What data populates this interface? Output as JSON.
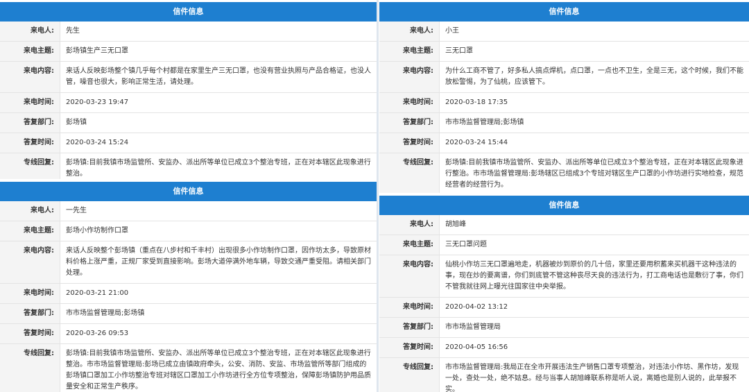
{
  "cards": [
    {
      "header": "信件信息",
      "rows": [
        {
          "label": "来电人:",
          "value": "先生"
        },
        {
          "label": "来电主题:",
          "value": "彭场镇生产三无口罩"
        },
        {
          "label": "来电内容:",
          "value": "来话人反映彭场整个镇几乎每个村都是在家里生产三无口罩，也没有营业执照与产品合格证，也没人管，噪音也很大，影响正常生活，请处理。"
        },
        {
          "label": "来电时间:",
          "value": "2020-03-23 19:47"
        },
        {
          "label": "答复部门:",
          "value": "彭场镇"
        },
        {
          "label": "答复时间:",
          "value": "2020-03-24 15:24"
        },
        {
          "label": "专线回复:",
          "value": "彭场镇:目前我镇市场监管所、安监办、派出所等单位已成立3个整治专班，正在对本辖区此现象进行整治。"
        }
      ]
    },
    {
      "header": "信件信息",
      "rows": [
        {
          "label": "来电人:",
          "value": "一先生"
        },
        {
          "label": "来电主题:",
          "value": "彭场小作坊制作口罩"
        },
        {
          "label": "来电内容:",
          "value": "来话人反映整个彭场镇（重点在八步村和千丰村）出现很多小作坊制作口罩，因作坊太多，导致原材料价格上涨严重，正规厂家受到直接影响。彭场大道停满外地车辆，导致交通严重受阻。请相关部门处理。"
        },
        {
          "label": "来电时间:",
          "value": "2020-03-21 21:00"
        },
        {
          "label": "答复部门:",
          "value": "市市场监督管理局;彭场镇"
        },
        {
          "label": "答复时间:",
          "value": "2020-03-26 09:53"
        },
        {
          "label": "专线回复:",
          "value": "彭场镇:目前我镇市场监管所、安监办、派出所等单位已成立3个整治专班，正在对本辖区此现象进行整治。市市场监督管理局:彭场已成立由镇政府牵头，公安、消防、安监、市场监管所等部门组成的彭场镇口罩加工小作坊整治专班对辖区口罩加工小作坊进行全方位专项整治，保障彭场镇防护用品质量安全和正常生产秩序。"
        }
      ]
    },
    {
      "header": "信件信息",
      "rows": [
        {
          "label": "来电人:",
          "value": "小王"
        },
        {
          "label": "来电主题:",
          "value": "三无口罩"
        },
        {
          "label": "来电内容:",
          "value": "为什么工商不管了，好多私人搞点焊机，点口罩，一点也不卫生，全是三无，这个时候，我们不能放松警惕，为了仙桃，应该管下。"
        },
        {
          "label": "来电时间:",
          "value": "2020-03-18 17:35"
        },
        {
          "label": "答复部门:",
          "value": "市市场监督管理局;彭场镇"
        },
        {
          "label": "答复时间:",
          "value": "2020-03-24 15:44"
        },
        {
          "label": "专线回复:",
          "value": "彭场镇:目前我镇市场监管所、安监办、派出所等单位已成立3个整治专班，正在对本辖区此现象进行整治。市市场监督管理局:彭场辖区已组成3个专班对辖区生产口罩的小作坊进行实地检查，规范经营者的经营行为。"
        }
      ]
    },
    {
      "header": "信件信息",
      "rows": [
        {
          "label": "来电人:",
          "value": "胡旭峰"
        },
        {
          "label": "来电主题:",
          "value": "三无口罩问题"
        },
        {
          "label": "来电内容:",
          "value": "仙桃小作坊三无口罩遍地走，机器被炒到原价的几十倍，家里还要用积蓄来买机器干这种违法的事，现在炒的要离谱，你们到底管不管这种丧尽天良的违法行为，打工商电话也是敷衍了事，你们不管我就往网上曝光往国家往中央举报。"
        },
        {
          "label": "来电时间:",
          "value": "2020-04-02 13:12"
        },
        {
          "label": "答复部门:",
          "value": "市市场监督管理局"
        },
        {
          "label": "答复时间:",
          "value": "2020-04-05 16:56"
        },
        {
          "label": "专线回复:",
          "value": "市市场监督管理局:我局正在全市开展违法生产销售口罩专项整治，对违法小作坊、黑作坊，发现一处，查处一处，绝不姑息。经与当事人胡旭峰联系称是听人说，离婚也是别人说的，此举报不实。"
        }
      ]
    }
  ]
}
